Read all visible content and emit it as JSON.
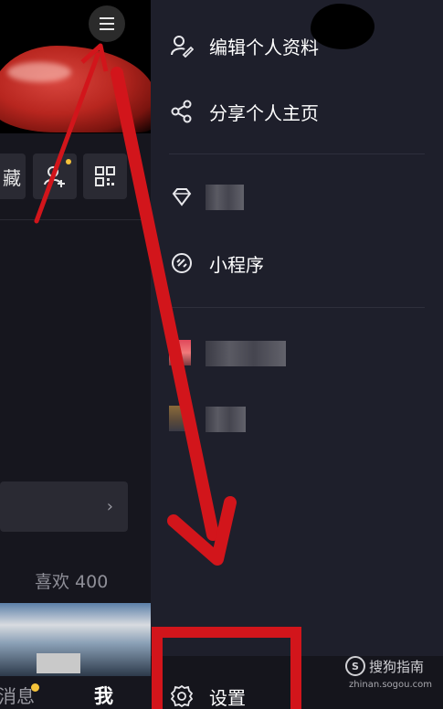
{
  "left_page": {
    "fav_label": "藏",
    "likes_label": "喜欢 400",
    "tabs": {
      "messages": "消息",
      "me": "我"
    }
  },
  "drawer": {
    "items": [
      {
        "label": "编辑个人资料",
        "icon": "edit-profile-icon"
      },
      {
        "label": "分享个人主页",
        "icon": "share-icon"
      },
      {
        "label": "",
        "icon": "diamond-icon"
      },
      {
        "label": "小程序",
        "icon": "link-icon"
      },
      {
        "label": "",
        "icon": ""
      },
      {
        "label": "",
        "icon": ""
      }
    ],
    "settings_label": "设置"
  },
  "watermark": {
    "brand": "搜狗指南",
    "url": "zhinan.sogou.com"
  },
  "colors": {
    "drawer_bg": "#1e1f2b",
    "annotation_red": "#d2151b",
    "notification_yellow": "#f5c33b"
  }
}
